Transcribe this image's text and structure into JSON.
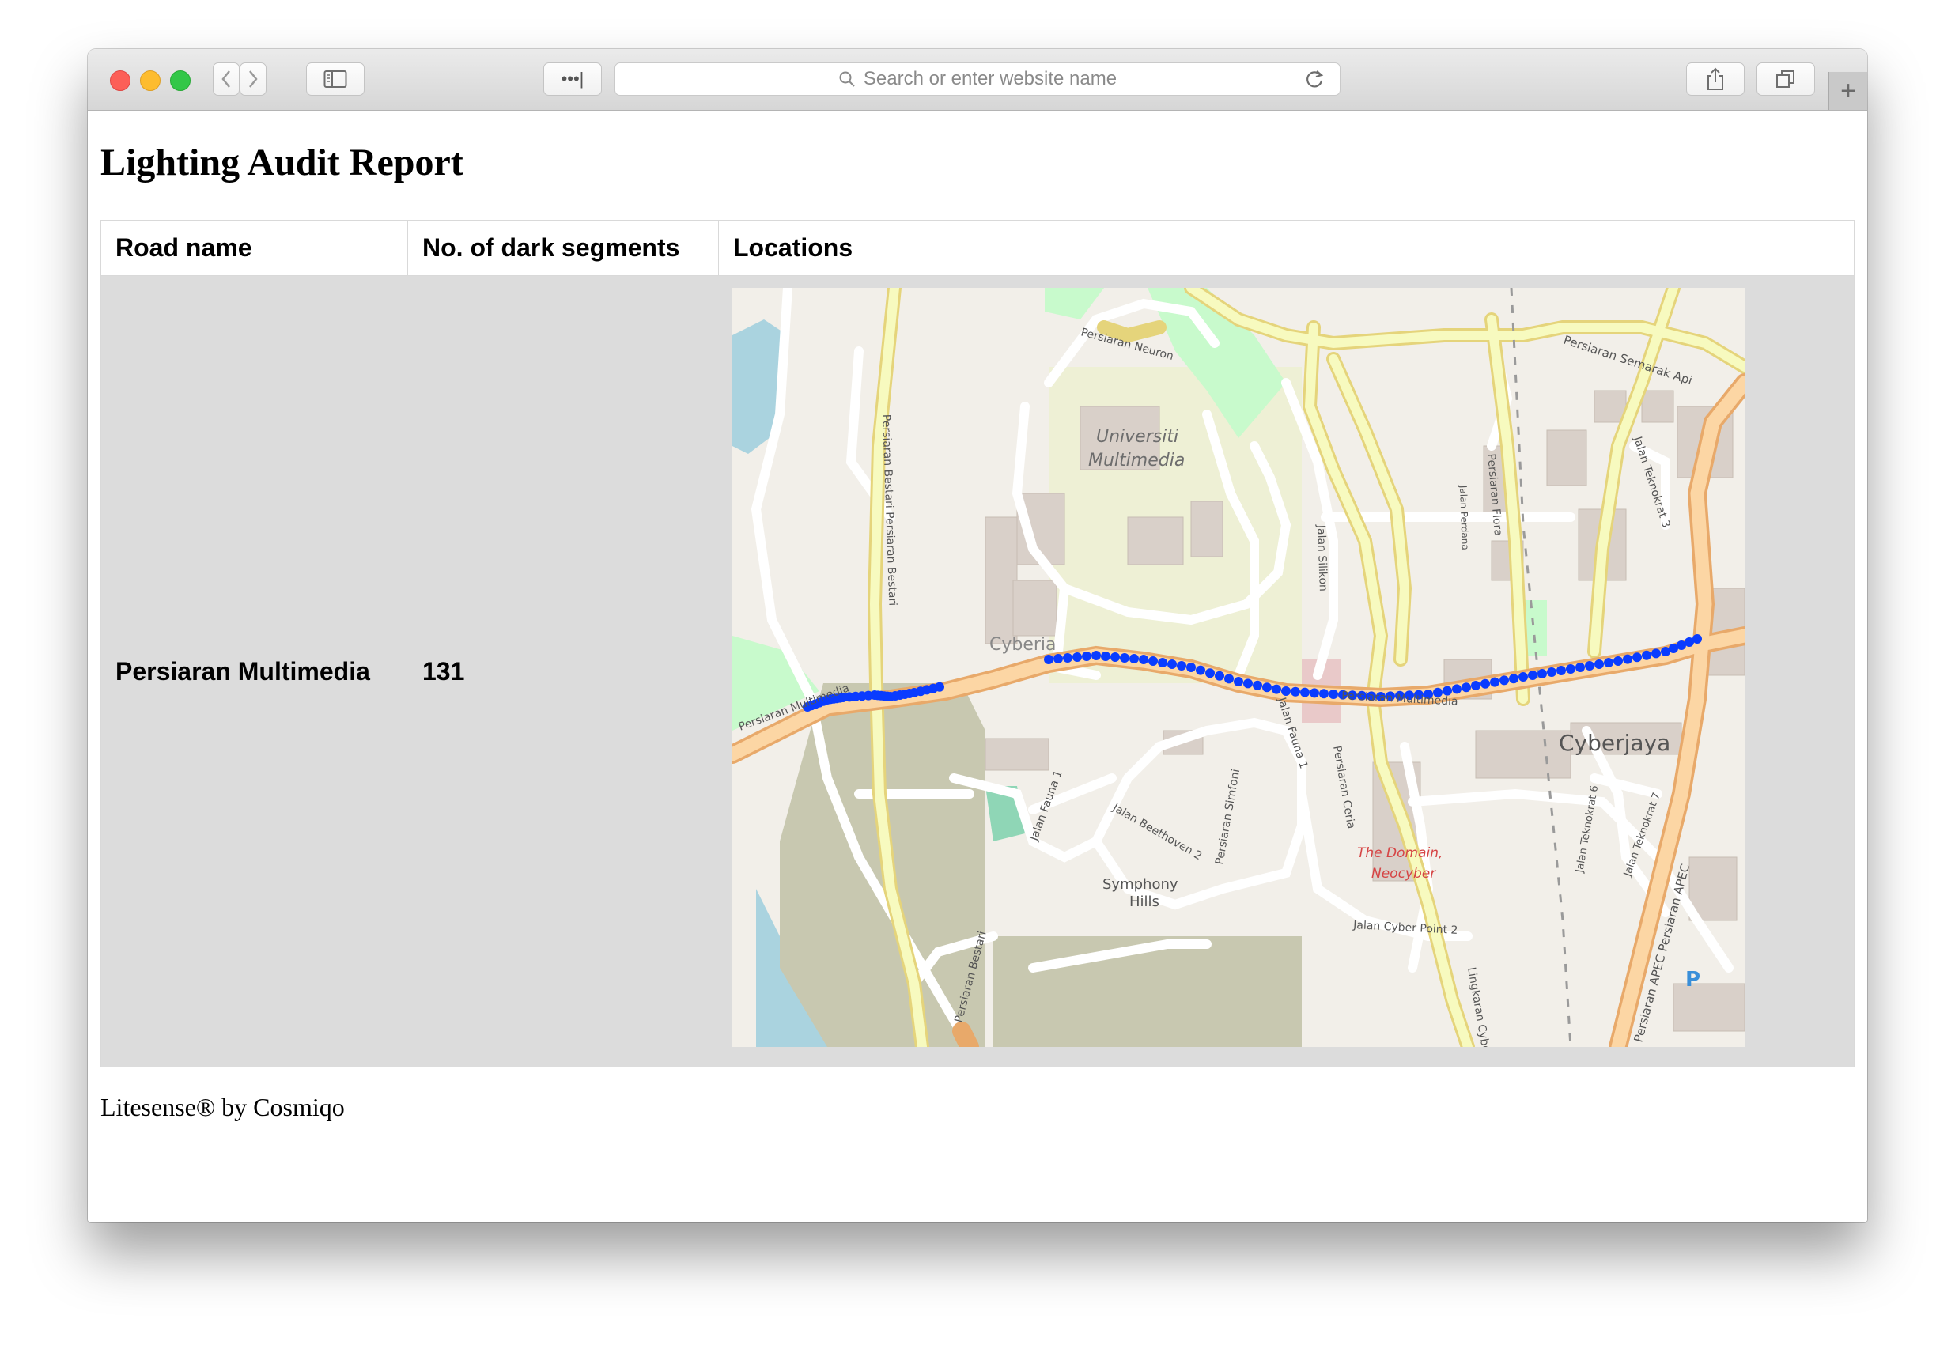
{
  "browser": {
    "address_placeholder": "Search or enter website name",
    "dots_button": "•••|",
    "plus_tab": "+"
  },
  "page": {
    "title": "Lighting Audit Report",
    "table": {
      "headers": [
        "Road name",
        "No. of dark segments",
        "Locations"
      ],
      "rows": [
        {
          "road_name": "Persiaran Multimedia",
          "dark_segments": "131"
        }
      ]
    },
    "footer": "Litesense® by Cosmiqo"
  },
  "map": {
    "labels": {
      "neuron": "Persiaran Neuron",
      "universiti": "Universiti",
      "multimedia": "Multimedia",
      "semarak": "Persiaran Semarak Api",
      "teknokrat3": "Jalan Teknokrat 3",
      "flora": "Persiaran Flora",
      "perdana": "Jalan Perdana",
      "silikon": "Jalan Silikon",
      "bestari_a": "Persiaran Bestari Persiaran Bestari",
      "cyberia": "Cyberia",
      "multimedia_west": "Persiaran Multimedia",
      "multimedia_east": "Persiaran Multimedia",
      "fauna1a": "Jalan Fauna 1",
      "fauna1b": "Jalan Fauna 1",
      "simfoni": "Persiaran Simfoni",
      "beethoven": "Jalan Beethoven 2",
      "ceria": "Persiaran Ceria",
      "symphony": "Symphony",
      "hills": "Hills",
      "domain1": "The Domain,",
      "domain2": "Neocyber",
      "cyberpoint": "Jalan Cyber Point 2",
      "lingkaran": "Lingkaran Cyber",
      "cyberjaya": "Cyberjaya",
      "teknokrat6": "Jalan Teknokrat 6",
      "teknokrat7": "Jalan Teknokrat 7",
      "apec": "Persiaran APEC Persiaran APEC",
      "bestari_b": "Persiaran Bestari",
      "parking": "P"
    },
    "colors": {
      "background": "#f2efe9",
      "primary_road": "#fcd6a4",
      "secondary_road": "#f7fabf",
      "minor_road": "#ffffff",
      "park": "#c8facc",
      "wood": "#c8c8b0",
      "water": "#aad3df",
      "building": "#d9d0c9",
      "dark_segment": "#0a3cff"
    }
  }
}
